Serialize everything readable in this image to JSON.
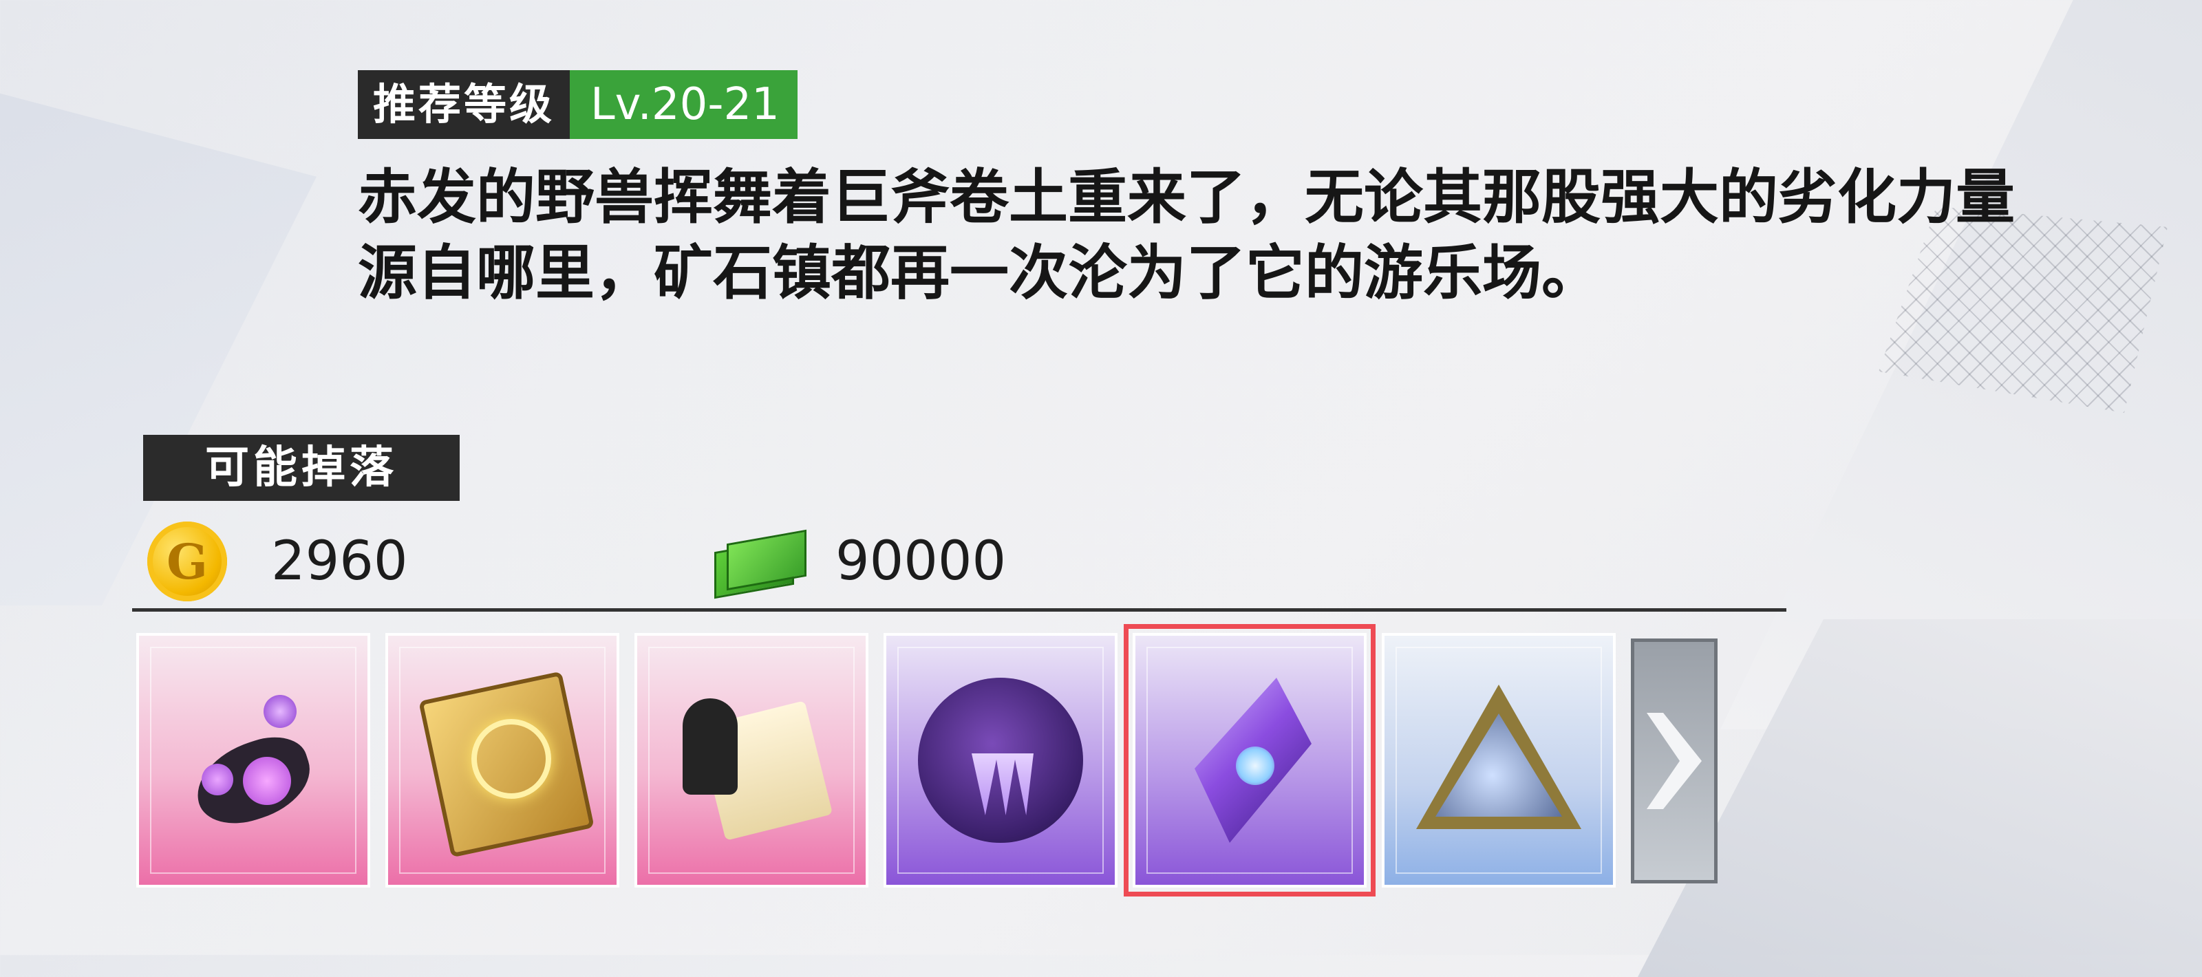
{
  "recommended": {
    "label": "推荐等级",
    "level": "Lv.20-21"
  },
  "description": {
    "line1": "赤发的野兽挥舞着巨斧卷土重来了，无论其那股强大的劣化力量",
    "line2": "源自哪里，矿石镇都再一次沦为了它的游乐场。"
  },
  "drops": {
    "label": "可能掉落",
    "coin": {
      "icon": "gold-coin-icon",
      "symbol": "G",
      "amount": "2960"
    },
    "cash": {
      "icon": "cash-bundle-icon",
      "amount": "90000"
    },
    "items": [
      {
        "name": "purple-orb-fragment-icon",
        "rarity": "pink"
      },
      {
        "name": "golden-tome-icon",
        "rarity": "pink"
      },
      {
        "name": "knight-scroll-icon",
        "rarity": "pink"
      },
      {
        "name": "claw-seal-icon",
        "rarity": "purple"
      },
      {
        "name": "purple-crystal-icon",
        "rarity": "purple",
        "selected": true
      },
      {
        "name": "triangle-prism-icon",
        "rarity": "blue"
      }
    ],
    "next_icon": "chevron-right-icon"
  },
  "colors": {
    "level_green": "#3aa33a",
    "tag_dark": "#2a2a2a",
    "selected_border": "#ee4b54"
  }
}
